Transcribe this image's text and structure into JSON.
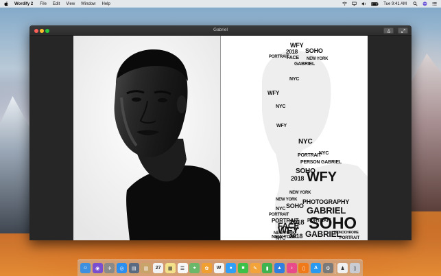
{
  "menubar": {
    "app_name": "Wordify 2",
    "menus": [
      "File",
      "Edit",
      "View",
      "Window",
      "Help"
    ],
    "clock": "Tue 9:41 AM"
  },
  "window": {
    "title": "Gabriel"
  },
  "word_portrait": {
    "words": [
      {
        "text": "WFY",
        "size": 9
      },
      {
        "text": "2018",
        "size": 8
      },
      {
        "text": "FACE",
        "size": 7
      },
      {
        "text": "SOHO",
        "size": 9
      },
      {
        "text": "GABRIEL",
        "size": 7
      },
      {
        "text": "NEW YORK",
        "size": 6
      },
      {
        "text": "PORTRAIT",
        "size": 6
      },
      {
        "text": "NYC",
        "size": 7
      },
      {
        "text": "WFY",
        "size": 8
      },
      {
        "text": "NYC",
        "size": 7
      },
      {
        "text": "WFY",
        "size": 7
      },
      {
        "text": "NYC",
        "size": 10
      },
      {
        "text": "PORTRAIT",
        "size": 7
      },
      {
        "text": "NYC",
        "size": 7
      },
      {
        "text": "PERSON",
        "size": 7
      },
      {
        "text": "SOHO",
        "size": 10
      },
      {
        "text": "GABRIEL",
        "size": 7
      },
      {
        "text": "2018",
        "size": 9
      },
      {
        "text": "NEW YORK",
        "size": 6
      },
      {
        "text": "NEW YORK",
        "size": 6
      },
      {
        "text": "SOHO",
        "size": 9
      },
      {
        "text": "WFY",
        "size": 20
      },
      {
        "text": "PORTRAIT",
        "size": 6
      },
      {
        "text": "NYC",
        "size": 7
      },
      {
        "text": "PORTRAIT",
        "size": 8
      },
      {
        "text": "PHOTOGRAPHY",
        "size": 9
      },
      {
        "text": "NEW YORK",
        "size": 6
      },
      {
        "text": "2018",
        "size": 10
      },
      {
        "text": "GABRIEL",
        "size": 13
      },
      {
        "text": "PORTRAIT",
        "size": 7
      },
      {
        "text": "WFY",
        "size": 14
      },
      {
        "text": "SOHO",
        "size": 24
      },
      {
        "text": "FACE",
        "size": 12
      },
      {
        "text": "NEW YORK",
        "size": 7
      },
      {
        "text": "NYC",
        "size": 7
      },
      {
        "text": "2018",
        "size": 9
      },
      {
        "text": "GABRIEL",
        "size": 12
      },
      {
        "text": "MONOCHROME",
        "size": 5
      },
      {
        "text": "PORTRAIT",
        "size": 6
      }
    ]
  },
  "dock": {
    "apps": [
      {
        "name": "finder-icon",
        "color": "#3d8fe0",
        "glyph": "☺"
      },
      {
        "name": "siri-icon",
        "color": "#7a4fcf",
        "glyph": "◉"
      },
      {
        "name": "launchpad-icon",
        "color": "#8a8a8a",
        "glyph": "✈"
      },
      {
        "name": "safari-icon",
        "color": "#2c8ff0",
        "glyph": "◎"
      },
      {
        "name": "photo-browser-icon",
        "color": "#5a6a80",
        "glyph": "▤"
      },
      {
        "name": "notes-icon",
        "color": "#c9a46a",
        "glyph": "▥"
      },
      {
        "name": "calendar-icon",
        "color": "#f2f2f2",
        "glyph": "27"
      },
      {
        "name": "stickies-icon",
        "color": "#f4e28a",
        "glyph": "▦"
      },
      {
        "name": "reminders-icon",
        "color": "#f7f7f7",
        "glyph": "☰"
      },
      {
        "name": "maps-icon",
        "color": "#6cb86a",
        "glyph": "⌖"
      },
      {
        "name": "photos-icon",
        "color": "#f0a030",
        "glyph": "✿"
      },
      {
        "name": "wordify-icon",
        "color": "#f5f5f5",
        "glyph": "W"
      },
      {
        "name": "messages-icon",
        "color": "#2f9ff8",
        "glyph": "●"
      },
      {
        "name": "facetime-icon",
        "color": "#3cc04a",
        "glyph": "■"
      },
      {
        "name": "pages-icon",
        "color": "#f2a33a",
        "glyph": "✎"
      },
      {
        "name": "numbers-icon",
        "color": "#3fb34f",
        "glyph": "▮"
      },
      {
        "name": "keynote-icon",
        "color": "#2f7fe0",
        "glyph": "▲"
      },
      {
        "name": "itunes-icon",
        "color": "#e94b8a",
        "glyph": "♪"
      },
      {
        "name": "ibooks-icon",
        "color": "#f07a1a",
        "glyph": "▯"
      },
      {
        "name": "app-store-icon",
        "color": "#2a9af0",
        "glyph": "A"
      },
      {
        "name": "system-preferences-icon",
        "color": "#7a7a7a",
        "glyph": "⚙"
      },
      {
        "name": "wordify-document-icon",
        "color": "#f0f0f0",
        "glyph": "♟"
      },
      {
        "name": "trash-icon",
        "color": "#c9ccd2",
        "glyph": "▯"
      }
    ]
  }
}
